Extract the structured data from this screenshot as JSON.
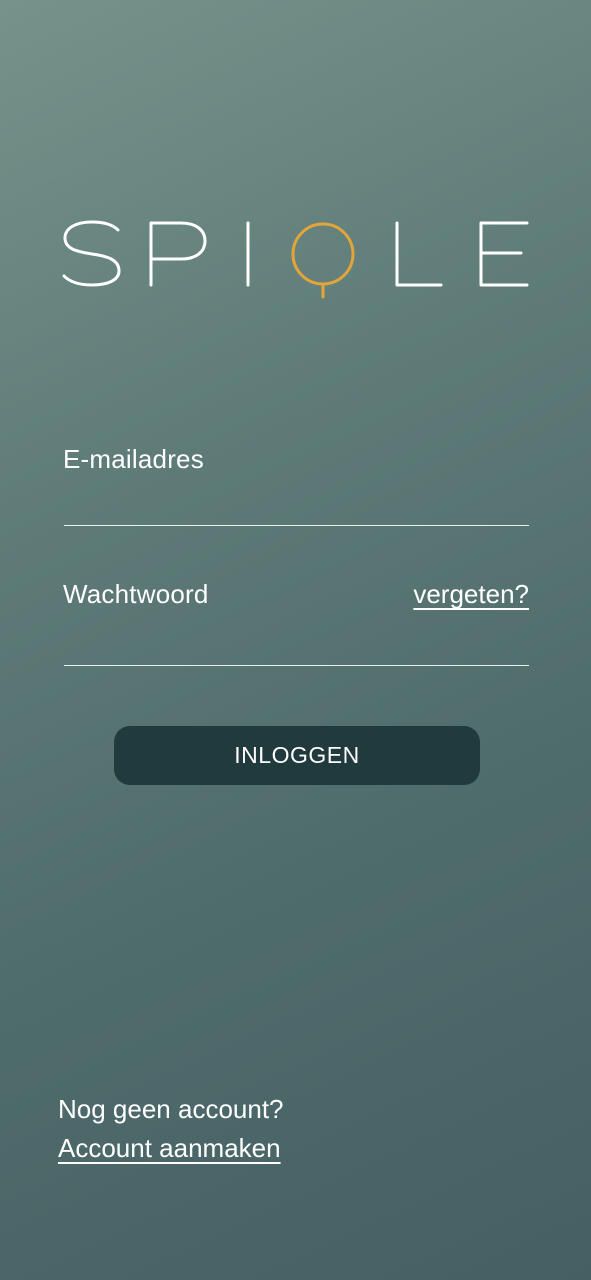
{
  "brand": {
    "logo_text": "SPIQLE",
    "accent_color": "#e2a53a",
    "text_color": "#ffffff"
  },
  "form": {
    "email_label": "E-mailadres",
    "email_value": "",
    "password_label": "Wachtwoord",
    "password_value": "",
    "forgot_link": "vergeten?",
    "login_button": "INLOGGEN"
  },
  "footer": {
    "no_account_text": "Nog geen account?",
    "create_account_link": "Account aanmaken"
  },
  "colors": {
    "background_top": "#76928a",
    "background_bottom": "#465f63",
    "button_background": "#213a3d"
  }
}
